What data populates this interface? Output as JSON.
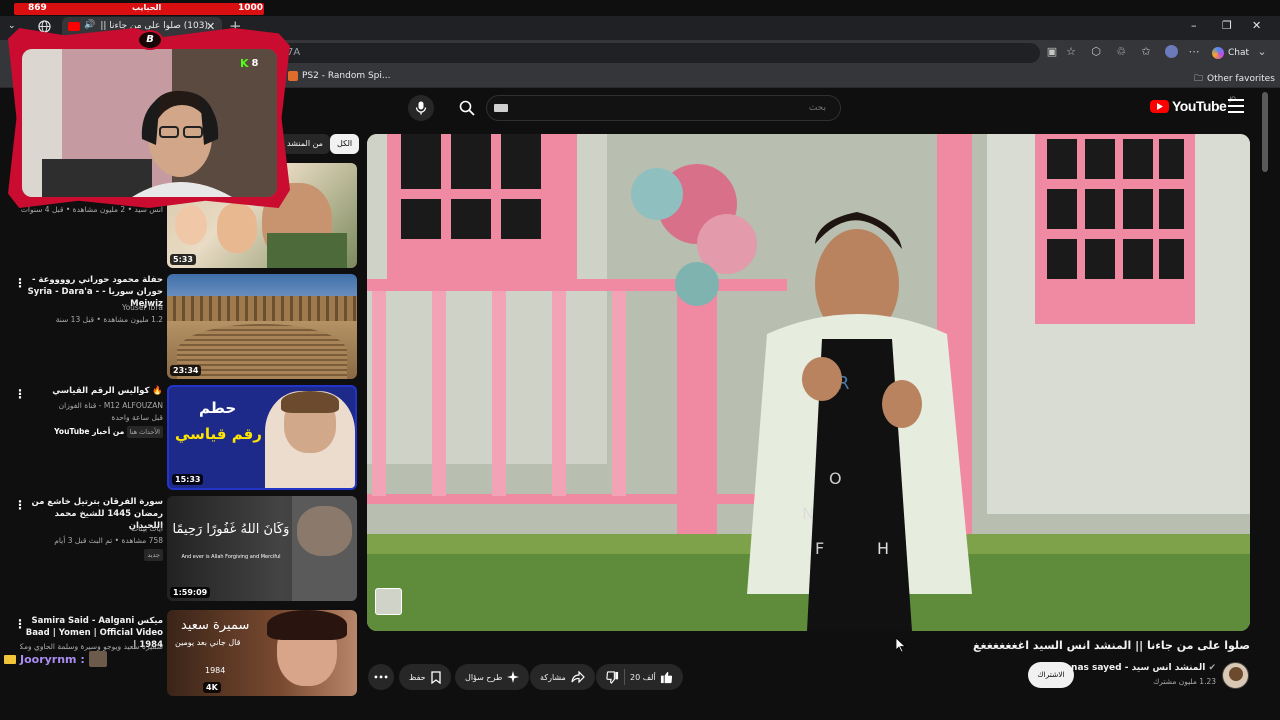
{
  "overlay": {
    "left_number": "869",
    "label": "الحبايب",
    "right_number": "1000"
  },
  "browser": {
    "tab_title": "(103) صلوا على من جاءنا || المنشد انس السيد",
    "url_fragment": "7A",
    "bookmarks": [
      {
        "label": "PS2 - Random Spi..."
      }
    ],
    "other_favorites": "Other favorites",
    "chat_label": "Chat",
    "window_controls": {
      "minimize": "–",
      "restore": "❐",
      "close": "✕"
    }
  },
  "webcam": {
    "viewer_count": "8",
    "medal_letter": "B"
  },
  "chat_overlay": {
    "username": "Jooryrnm :"
  },
  "youtube": {
    "logo_text": "YouTube",
    "logo_region": "JO",
    "search_placeholder": "بحث",
    "chips": [
      {
        "label": "الكل"
      },
      {
        "label": "من المنشد"
      }
    ],
    "recommendations": [
      {
        "title": "",
        "meta1": "انس سيد • 2 مليون مشاهدة • قبل 4 سنوات",
        "meta2": "",
        "duration": "5:33"
      },
      {
        "title": "حفلة محمود حوراني رووووعة - حوران سوريا - Syria - Dara'a - Mejwiz",
        "meta1": "Yousef ibra",
        "meta2": "1.2 مليون مشاهدة • قبل 13 سنة",
        "duration": "23:34"
      },
      {
        "title": "🔥 كواليس الرقم القياسي",
        "meta1": "M12 ALFOUZAN - قناة الفوزان",
        "meta2": "قبل ساعة واحدة",
        "meta3": "من أخبار YouTube",
        "badge": "الأحداث هنا",
        "duration": "15:33",
        "thumb_text_1": "حطم",
        "thumb_text_2": "رقم قياسي"
      },
      {
        "title": "سورة الفرقان بترتيل خاشع من رمضان 1445 للشيخ محمد اللحيدان",
        "meta1": "آيات بينات",
        "meta2": "758 مشاهدة • تم البث قبل 3 أيام",
        "badge": "جديد",
        "duration": "1:59:09",
        "thumb_text_1": "وَكَانَ اللَّهُ غَفُورًا رَحِيمًا",
        "thumb_text_2": "And ever is Allah Forgiving and Merciful"
      },
      {
        "title": "ميكس Samira Said - Aalgani Baad | Yomen | Official Video | 1984",
        "meta1": "سميرة سعيد ويوجو وسيرة وسلمة الحاوي ومكانش وكذا",
        "meta2": "",
        "duration": "",
        "thumb_text_1": "سميرة سعيد",
        "thumb_text_2": "قال جاني بعد يومين",
        "thumb_text_3": "1984",
        "thumb_badge": "4K"
      }
    ],
    "video": {
      "title": "صلوا على من جاءنا || المنشد انس السيد اغغغغغغغغ",
      "channel_name": "المنشد انس سيد - anas sayed",
      "subscribers": "1.23 مليون مشترك",
      "subscribe_label": "الاشتراك",
      "likes": "20 ألف",
      "share_label": "مشاركة",
      "ask_label": "طرح سؤال",
      "save_label": "حفظ",
      "more_label": "•••"
    }
  }
}
